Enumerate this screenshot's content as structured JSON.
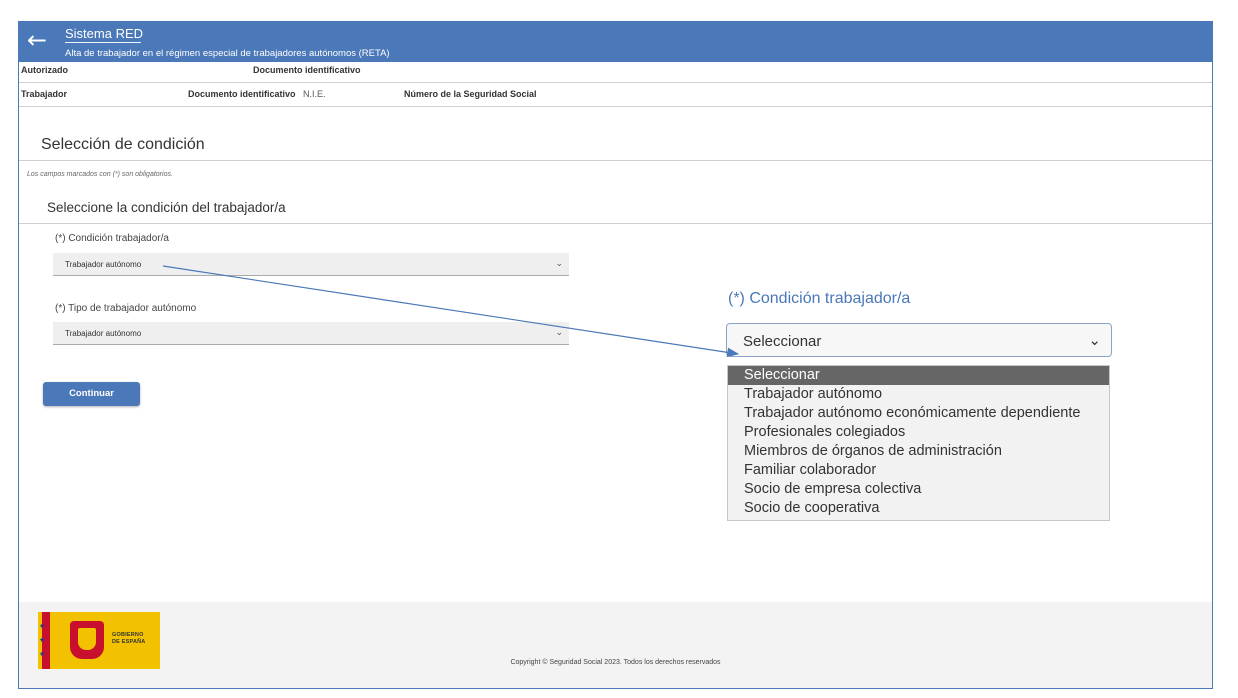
{
  "app": {
    "back_icon": "arrow-left-icon",
    "title": "Sistema RED",
    "subtitle": "Alta de trabajador en el régimen especial de trabajadores autónomos (RETA)"
  },
  "info": {
    "autorizado_label": "Autorizado",
    "autorizado_doc_label": "Documento identificativo",
    "trabajador_label": "Trabajador",
    "trabajador_doc_label": "Documento identificativo",
    "trabajador_doc_value": "N.I.E.",
    "nss_label": "Número de la Seguridad Social"
  },
  "main": {
    "section_title": "Selección de condición",
    "mandatory_note": "Los campos marcados con (*) son obligatorios.",
    "subsection_title": "Seleccione la condición del trabajador/a",
    "condicion_label": "(*) Condición trabajador/a",
    "condicion_value": "Trabajador autónomo",
    "tipo_label": "(*) Tipo de trabajador autónomo",
    "tipo_value": "Trabajador autónomo",
    "continue_label": "Continuar"
  },
  "zoom": {
    "label": "(*) Condición trabajador/a",
    "selected": "Seleccionar",
    "options": [
      "Seleccionar",
      "Trabajador autónomo",
      "Trabajador autónomo económicamente dependiente",
      "Profesionales colegiados",
      "Miembros de órganos de administración",
      "Familiar colaborador",
      "Socio de empresa colectiva",
      "Socio de cooperativa"
    ]
  },
  "footer": {
    "logo_text_1": "GOBIERNO",
    "logo_text_2": "DE ESPAÑA",
    "copyright": "Copyright © Seguridad Social 2023. Todos los derechos reservados"
  },
  "colors": {
    "primary": "#4a78b8",
    "option_selected_bg": "#666666"
  }
}
